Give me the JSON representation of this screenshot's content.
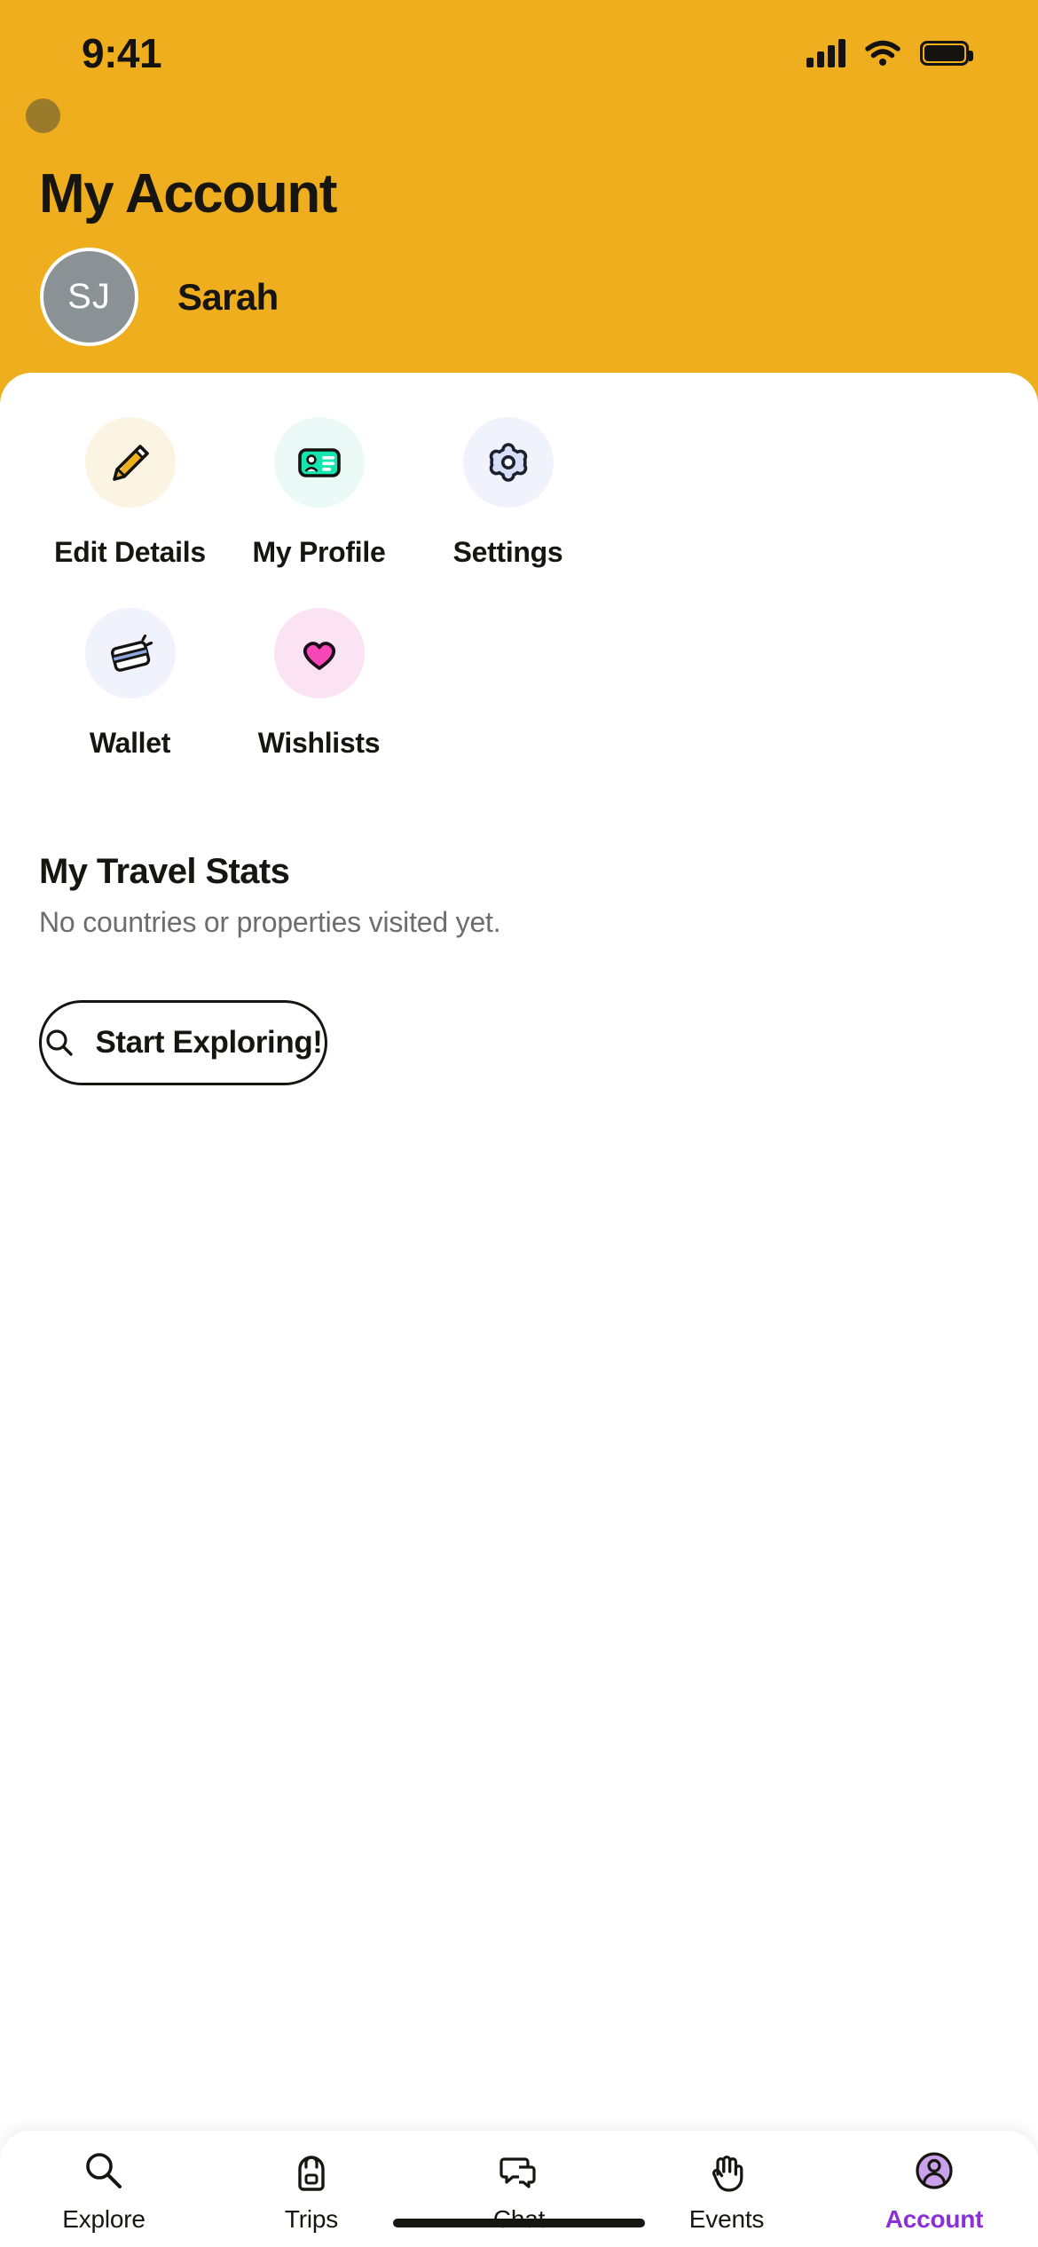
{
  "status_bar": {
    "time": "9:41",
    "signal_icon": "cellular-signal-icon",
    "wifi_icon": "wifi-icon",
    "battery_icon": "battery-icon"
  },
  "header": {
    "background_color": "#EFAE1E",
    "title": "My Account",
    "indicator_dot_color": "#9A7B2B",
    "profile": {
      "initials": "SJ",
      "name": "Sarah",
      "avatar_color": "#8B9296"
    }
  },
  "quick_actions": [
    {
      "label": "Edit Details",
      "icon": "pencil-icon",
      "circle_color": "#FBF4E2",
      "accent": "#EFAE1E"
    },
    {
      "label": "My Profile",
      "icon": "id-card-icon",
      "circle_color": "#EBFAF6",
      "accent": "#15E5AE"
    },
    {
      "label": "Settings",
      "icon": "gear-icon",
      "circle_color": "#F1F3FC",
      "accent": "#D6DEF8"
    },
    {
      "label": "Wallet",
      "icon": "credit-card-icon",
      "circle_color": "#F1F3FC",
      "accent": "#8FA7E0"
    },
    {
      "label": "Wishlists",
      "icon": "heart-icon",
      "circle_color": "#FBE3F3",
      "accent": "#F746B8"
    }
  ],
  "travel_stats": {
    "title": "My Travel Stats",
    "empty_message": "No countries or properties visited yet."
  },
  "explore_button": {
    "label": "Start Exploring!",
    "icon": "search-icon"
  },
  "tab_bar": {
    "active_color": "#8B2FD6",
    "items": [
      {
        "label": "Explore",
        "icon": "search-icon",
        "active": false
      },
      {
        "label": "Trips",
        "icon": "backpack-icon",
        "active": false
      },
      {
        "label": "Chat",
        "icon": "chat-icon",
        "active": false
      },
      {
        "label": "Events",
        "icon": "wave-hand-icon",
        "active": false
      },
      {
        "label": "Account",
        "icon": "account-icon",
        "active": true
      }
    ]
  }
}
